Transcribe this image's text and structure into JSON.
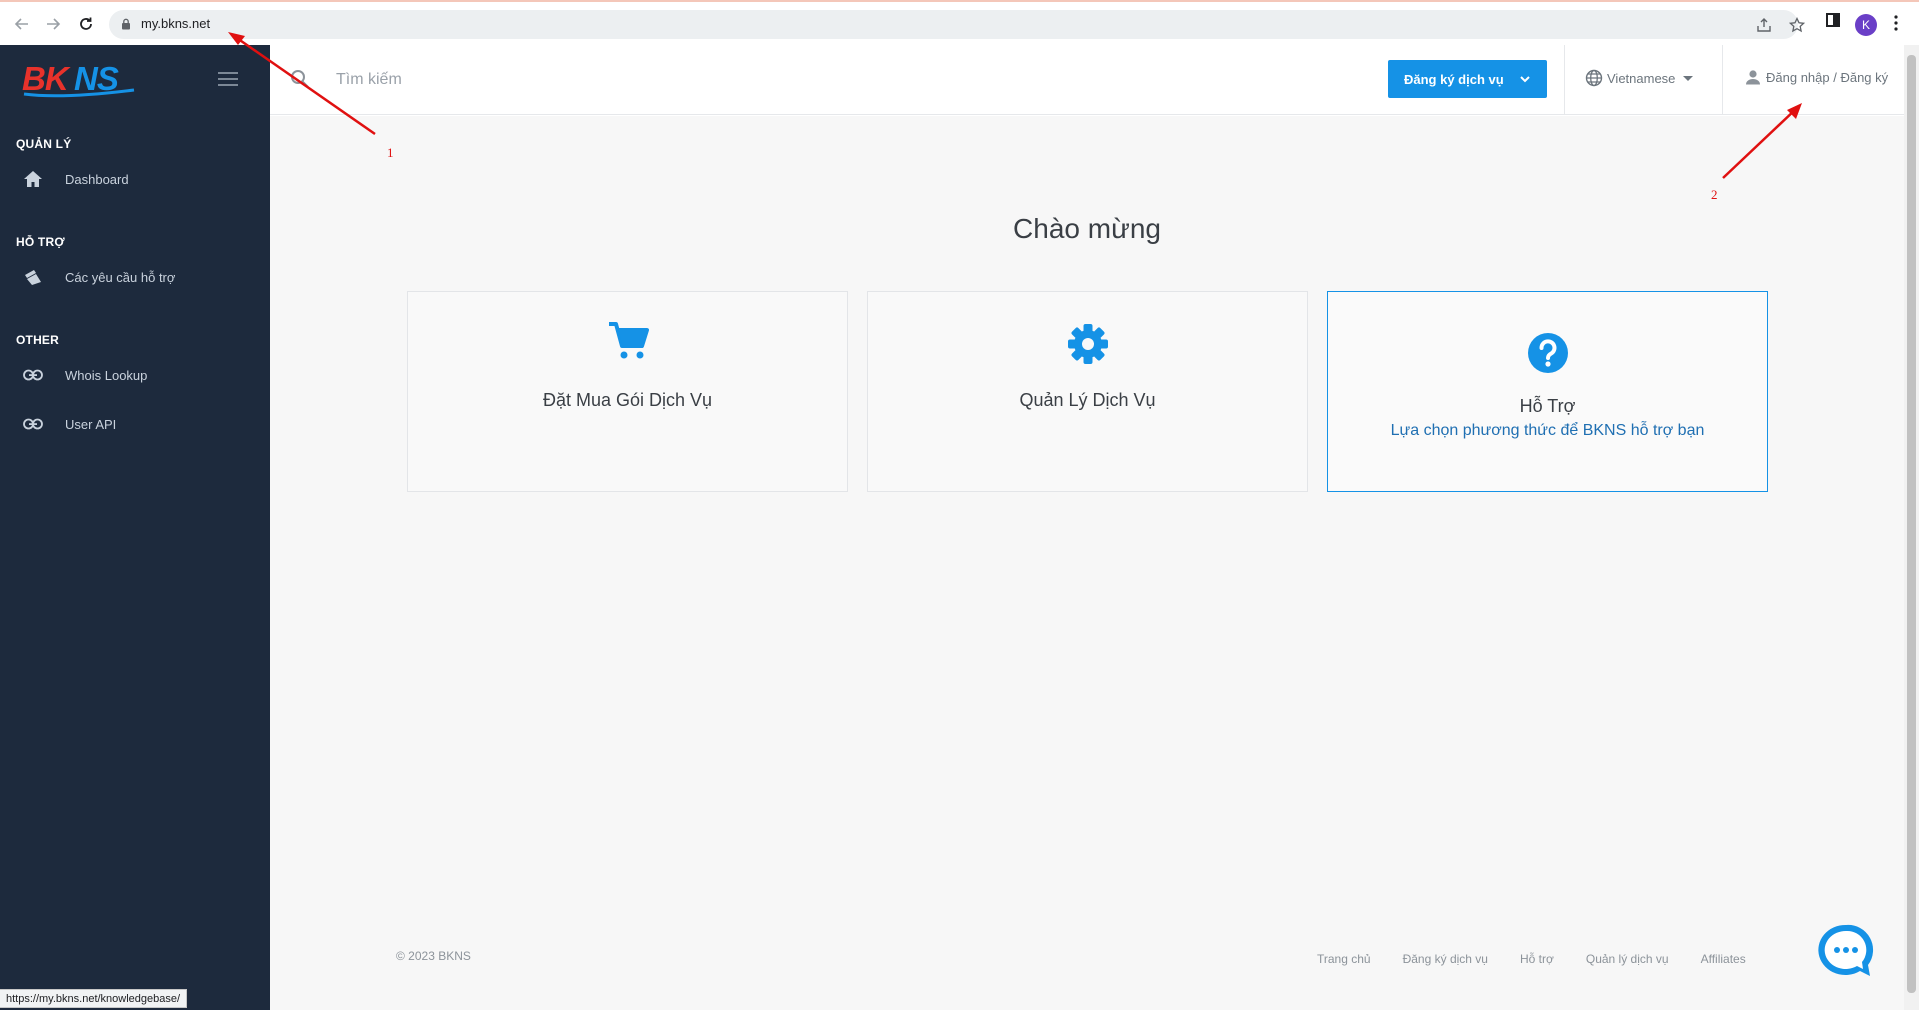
{
  "browser": {
    "url": "my.bkns.net",
    "profile_initial": "K",
    "status_url": "https://my.bkns.net/knowledgebase/"
  },
  "sidebar": {
    "logo": "BKNS",
    "sections": [
      {
        "title": "QUẢN LÝ",
        "items": [
          {
            "label": "Dashboard",
            "icon": "home-icon"
          }
        ]
      },
      {
        "title": "HỖ TRỢ",
        "items": [
          {
            "label": "Các yêu cầu hỗ trợ",
            "icon": "ticket-icon"
          }
        ]
      },
      {
        "title": "OTHER",
        "items": [
          {
            "label": "Whois Lookup",
            "icon": "link-icon"
          },
          {
            "label": "User API",
            "icon": "link-icon"
          }
        ]
      }
    ]
  },
  "header": {
    "search_placeholder": "Tìm kiếm",
    "register_button": "Đăng ký dịch vụ",
    "language": "Vietnamese",
    "login": "Đăng nhập / Đăng ký"
  },
  "main": {
    "welcome": "Chào mừng",
    "cards": [
      {
        "title": "Đặt Mua Gói Dịch Vụ",
        "icon": "cart-icon"
      },
      {
        "title": "Quản Lý Dịch Vụ",
        "icon": "gear-icon"
      },
      {
        "title": "Hỗ Trợ",
        "subtitle": "Lựa chọn phương thức để BKNS hỗ trợ bạn",
        "icon": "question-icon"
      }
    ]
  },
  "footer": {
    "copyright": "© 2023 BKNS",
    "links": [
      "Trang chủ",
      "Đăng ký dịch vụ",
      "Hỗ trợ",
      "Quản lý dịch vụ",
      "Affiliates"
    ]
  },
  "annotations": [
    "1",
    "2"
  ],
  "colors": {
    "sidebar_bg": "#1d2a3d",
    "accent": "#1592e6",
    "logo_red": "#e8322b",
    "logo_blue": "#1592e6",
    "annotation_red": "#e01010"
  }
}
